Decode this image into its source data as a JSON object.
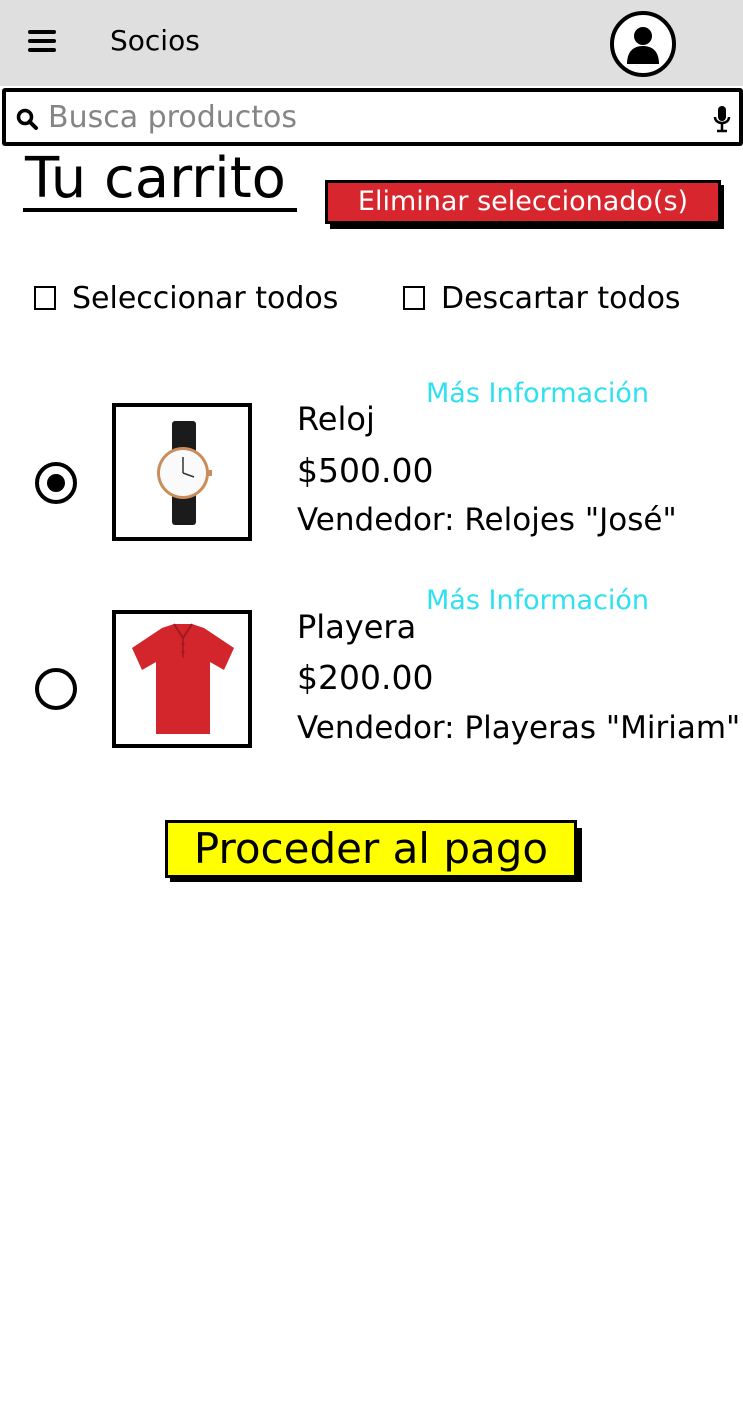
{
  "header": {
    "app_title": "Socios",
    "menu_icon": "hamburger-menu-icon",
    "profile_icon": "user-avatar-icon",
    "background_color": "#dfdfdf"
  },
  "search": {
    "placeholder": "Busca productos",
    "value": "",
    "left_icon": "search-icon",
    "right_icon": "microphone-icon"
  },
  "cart": {
    "title": "Tu carrito",
    "delete_selected_label": "Eliminar seleccionado(s)",
    "select_all_label": "Seleccionar todos",
    "discard_all_label": "Descartar todos"
  },
  "items": [
    {
      "name": "Reloj",
      "price": "$500.00",
      "seller": "Vendedor: Relojes \"José\"",
      "more_info_label": "Más Información",
      "selected": true,
      "image_icon": "wristwatch-image"
    },
    {
      "name": "Playera",
      "price": "$200.00",
      "seller": "Vendedor: Playeras \"Miriam\"",
      "more_info_label": "Más Información",
      "selected": false,
      "image_icon": "red-polo-shirt-image"
    }
  ],
  "checkout": {
    "proceed_label": "Proceder al pago"
  },
  "colors": {
    "delete_button": "#d8262e",
    "proceed_button": "#ffff00",
    "more_info_link": "#2ee0f0"
  }
}
